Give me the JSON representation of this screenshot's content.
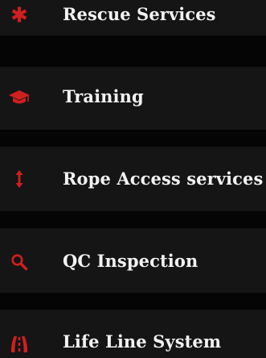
{
  "menu": {
    "accent_color": "#d01f1f",
    "items": [
      {
        "label": "Rescue Services",
        "icon": "asterisk-icon"
      },
      {
        "label": "Training",
        "icon": "graduation-cap-icon"
      },
      {
        "label": "Rope Access services",
        "icon": "vertical-arrows-icon"
      },
      {
        "label": "QC Inspection",
        "icon": "search-icon"
      },
      {
        "label": "Life Line System",
        "icon": "road-icon"
      }
    ]
  }
}
